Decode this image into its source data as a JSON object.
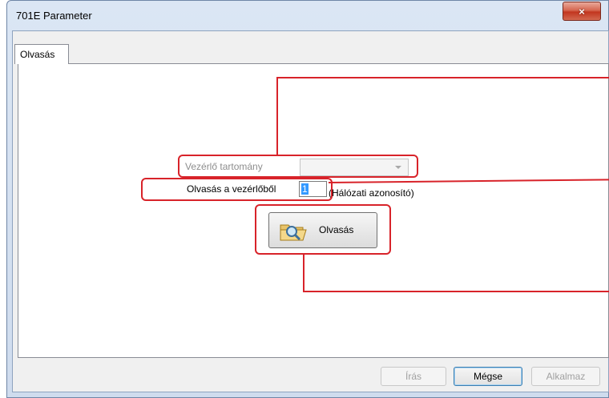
{
  "window": {
    "title": "701E Parameter",
    "close_icon": "×"
  },
  "tabs": [
    {
      "label": "Olvasás"
    }
  ],
  "form": {
    "range_label": "Vezérlő tartomány",
    "range_value": "",
    "read_from_label": "Olvasás a vezérlőből",
    "network_id_value": "1",
    "network_id_hint": "(Hálózati azonosító)",
    "read_button_label": "Olvasás",
    "read_button_icon": "folder-search-icon"
  },
  "footer": {
    "write_label": "Írás",
    "cancel_label": "Mégse",
    "apply_label": "Alkalmaz"
  },
  "colors": {
    "highlight": "#d8232a",
    "selection": "#3399ff"
  }
}
